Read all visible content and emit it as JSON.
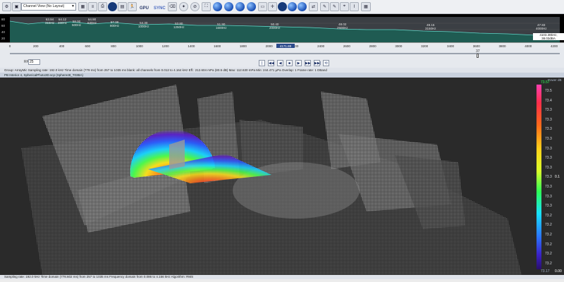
{
  "toolbar": {
    "layout_select": "Channel View (No Layout)",
    "gpu_label": "GPU",
    "sync_label": "SYNC",
    "icons": [
      "settings-icon",
      "save-icon",
      "layout-select",
      "tile-icon",
      "list-icon",
      "table-icon",
      "print-icon",
      "globe-icon",
      "film-icon",
      "text-icon",
      "run-icon",
      "gpu",
      "sync",
      "eraser-icon",
      "compass-icon",
      "no-icon",
      "map-icon",
      "globe-icon",
      "globe-icon",
      "globe-icon",
      "globe-icon",
      "screen-icon",
      "crosshair-icon",
      "disc-icon",
      "globe-icon",
      "globe-icon",
      "arrows-icon",
      "pin-icon",
      "pen-icon",
      "pen-icon",
      "chart-icon",
      "calculator-icon"
    ]
  },
  "spectrum": {
    "y_ticks": [
      "80",
      "60",
      "40",
      "20"
    ],
    "peaks": [
      {
        "value": "63.94",
        "freq": "315Hz"
      },
      {
        "value": "64.12",
        "freq": "400Hz"
      },
      {
        "value": "58.00",
        "freq": "500Hz"
      },
      {
        "value": "64.90",
        "freq": "630Hz"
      },
      {
        "value": "57.38",
        "freq": "800Hz"
      },
      {
        "value": "54.30",
        "freq": "1000Hz"
      },
      {
        "value": "53.80",
        "freq": "1250Hz"
      },
      {
        "value": "51.90",
        "freq": "1600Hz"
      },
      {
        "value": "50.40",
        "freq": "2000Hz"
      },
      {
        "value": "48.02",
        "freq": "2500Hz"
      },
      {
        "value": "49.15",
        "freq": "3150Hz"
      },
      {
        "value": "47.83",
        "freq": "4000Hz"
      }
    ],
    "cursor_readout": "4103.38kHz, 38.03dBA",
    "x_ticks": [
      "0",
      "200",
      "400",
      "600",
      "800",
      "1000",
      "1200",
      "1400",
      "1600",
      "1800",
      "2000",
      "2200",
      "2400",
      "2600",
      "2800",
      "3000",
      "3200",
      "3400",
      "3600",
      "3800",
      "4000",
      "4200"
    ],
    "center_label": "4171.88"
  },
  "transport": {
    "rate_label": "RPS",
    "rate_value": "25",
    "position_marker": "37",
    "buttons": [
      "|◀◀",
      "◀◀",
      "◀",
      "■",
      "▶",
      "▶▶",
      "▶▶|",
      "⟲"
    ]
  },
  "status_top": "Group: ArrayMic  Sampling rate: 192.0 kHz Time domain (779 ms) from 257 to 1035 ms blank: all channels from 0.012 to 4.164 kHz   Eff.: 212.604 mPa (80.5 dB)  Max: 112.630 mPa Min: 244.471 µPa Overlap: 1 Frame rate: 1 DBand",
  "view_title": "PB Interior 4, SphericalPhoto3D.scp (Sphere48_T03BA)",
  "legend": {
    "title": "Power dB",
    "top_value": "73.57",
    "ticks": [
      "73.5",
      "73.4",
      "73.3",
      "73.3",
      "73.3",
      "73.3",
      "73.3",
      "73.3",
      "73.3",
      "73.3",
      "73.3",
      "73.3",
      "73.3",
      "73.2",
      "73.2",
      "73.2",
      "73.2",
      "73.2",
      "73.2"
    ],
    "mid_label": "0.1",
    "bottom_value": "73.17",
    "bottom_right": "0.00",
    "colors": [
      "#ff3fb0",
      "#ff2e4a",
      "#ff6a1a",
      "#ffd21a",
      "#d8ff2a",
      "#2cff56",
      "#18e0ff",
      "#2a78ff",
      "#3a22c8"
    ]
  },
  "status_bottom": "Sampling rate: 192.0 kHz Time domain (778.602 ms) from 257 to 1035 ms Frequency domain from 0.086 to 4.156 kHz Algorithm: RMS"
}
